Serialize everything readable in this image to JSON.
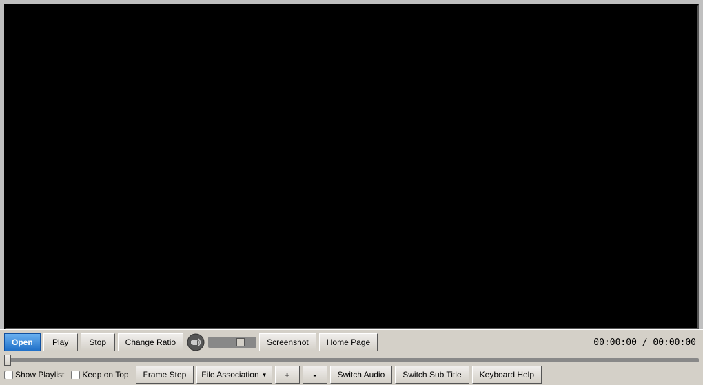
{
  "video": {
    "background": "#000000"
  },
  "controls": {
    "row1": {
      "open_label": "Open",
      "play_label": "Play",
      "stop_label": "Stop",
      "change_ratio_label": "Change Ratio",
      "screenshot_label": "Screenshot",
      "home_page_label": "Home Page",
      "time_display": "00:00:00 / 00:00:00",
      "volume_value": 70
    },
    "row2": {
      "show_playlist_label": "Show Playlist",
      "keep_on_top_label": "Keep on Top",
      "frame_step_label": "Frame Step",
      "file_association_label": "File Association",
      "plus_label": "+",
      "minus_label": "-",
      "switch_audio_label": "Switch Audio",
      "switch_sub_title_label": "Switch Sub Title",
      "keyboard_help_label": "Keyboard Help"
    }
  }
}
